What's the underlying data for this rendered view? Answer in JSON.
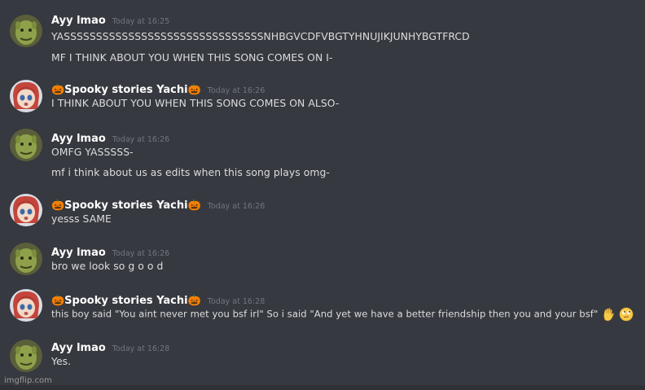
{
  "messages": [
    {
      "user": "Ayy lmao",
      "timestamp": "Today at 16:25",
      "avatar": "shrek-avatar",
      "lines": [
        "YASSSSSSSSSSSSSSSSSSSSSSSSSSSSSSSNHBGVCDFVBGTYHNUJIKJUNHYBGTFRCD",
        "MF I THINK ABOUT YOU WHEN THIS SONG COMES ON I-"
      ]
    },
    {
      "user": "🎃Spooky stories Yachi🎃",
      "timestamp": "Today at 16:26",
      "avatar": "anime-girl-avatar",
      "lines": [
        "I THINK ABOUT YOU WHEN THIS SONG COMES ON ALSO-"
      ]
    },
    {
      "user": "Ayy lmao",
      "timestamp": "Today at 16:26",
      "avatar": "shrek-avatar",
      "lines": [
        "OMFG YASSSSS-",
        "mf i think about us as edits when this song plays omg-"
      ]
    },
    {
      "user": "🎃Spooky stories Yachi🎃",
      "timestamp": "Today at 16:26",
      "avatar": "anime-girl-avatar",
      "lines": [
        "yesss SAME"
      ]
    },
    {
      "user": "Ayy lmao",
      "timestamp": "Today at 16:26",
      "avatar": "shrek-avatar",
      "lines": [
        "bro we look so g o o d"
      ]
    },
    {
      "user": "🎃Spooky stories Yachi🎃",
      "timestamp": "Today at 16:28",
      "avatar": "anime-girl-avatar",
      "lines": [
        "this boy said \"You aint never met you bsf irl\" So i said \"And yet we have a better friendship then you and your bsf\""
      ],
      "emojis": [
        "raised-hand-emoji",
        "rolling-eyes-emoji"
      ]
    },
    {
      "user": "Ayy lmao",
      "timestamp": "Today at 16:28",
      "avatar": "shrek-avatar",
      "lines": [
        "Yes."
      ]
    }
  ],
  "watermark": "imgflip.com",
  "colors": {
    "background": "#36393f",
    "username": "#ffffff",
    "timestamp": "#72767d",
    "text": "#dcddde"
  }
}
